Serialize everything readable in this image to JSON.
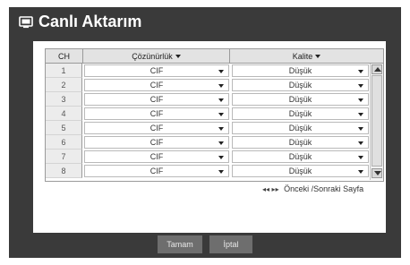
{
  "dialog": {
    "title": "Canlı Aktarım",
    "title_icon": "monitor-icon"
  },
  "table": {
    "headers": {
      "ch": "CH",
      "resolution": "Çözünürlük",
      "quality": "Kalite"
    },
    "rows": [
      {
        "ch": "1",
        "resolution": "CIF",
        "quality": "Düşük"
      },
      {
        "ch": "2",
        "resolution": "CIF",
        "quality": "Düşük"
      },
      {
        "ch": "3",
        "resolution": "CIF",
        "quality": "Düşük"
      },
      {
        "ch": "4",
        "resolution": "CIF",
        "quality": "Düşük"
      },
      {
        "ch": "5",
        "resolution": "CIF",
        "quality": "Düşük"
      },
      {
        "ch": "6",
        "resolution": "CIF",
        "quality": "Düşük"
      },
      {
        "ch": "7",
        "resolution": "CIF",
        "quality": "Düşük"
      },
      {
        "ch": "8",
        "resolution": "CIF",
        "quality": "Düşük"
      }
    ]
  },
  "pager": {
    "prev_symbol": "◂◂",
    "next_symbol": "▸▸",
    "label": "Önceki /Sonraki Sayfa"
  },
  "buttons": {
    "ok": "Tamam",
    "cancel": "İptal"
  },
  "colors": {
    "dialog_bg": "#3a3a3a",
    "button_bg": "#6e6e6e"
  }
}
